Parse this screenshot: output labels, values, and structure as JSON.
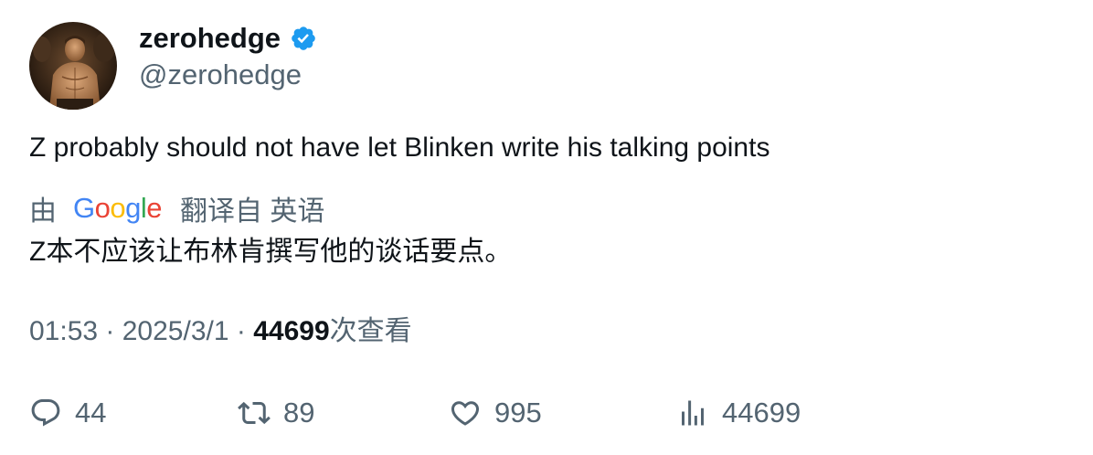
{
  "author": {
    "display_name": "zerohedge",
    "handle": "@zerohedge",
    "verified": true,
    "verified_color": "#1d9bf0",
    "avatar_icon": "avatar-photo"
  },
  "tweet": {
    "text": "Z probably should not have let Blinken write his talking points"
  },
  "translation": {
    "prefix": "由",
    "provider": "Google",
    "suffix": "翻译自 英语",
    "text": "Z本不应该让布林肯撰写他的谈话要点。"
  },
  "meta": {
    "time": "01:53",
    "separator": "·",
    "date": "2025/3/1",
    "views": "44699",
    "views_label": "次查看"
  },
  "actions": {
    "replies": "44",
    "retweets": "89",
    "likes": "995",
    "views": "44699"
  },
  "colors": {
    "text_primary": "#0f1419",
    "text_secondary": "#536471",
    "google_blue": "#4285F4",
    "google_red": "#EA4335",
    "google_yellow": "#FBBC05",
    "google_green": "#34A853"
  }
}
